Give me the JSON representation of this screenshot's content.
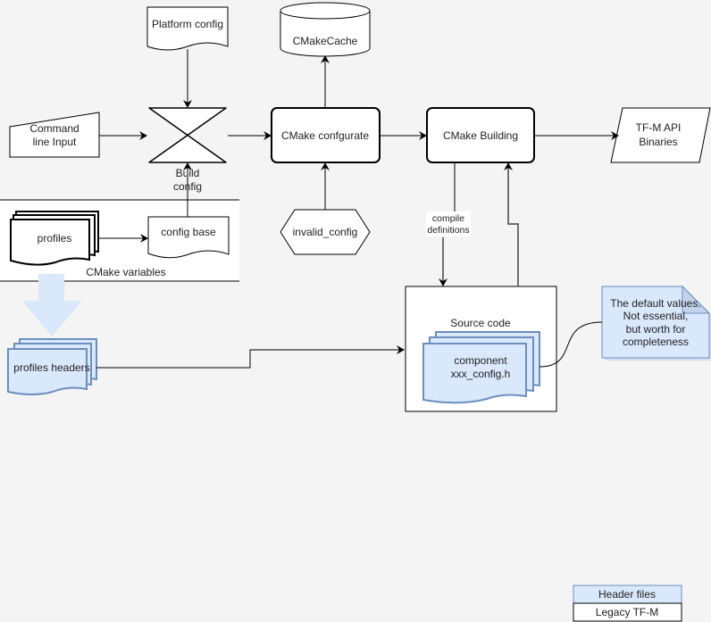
{
  "nodes": {
    "platform_config": "Platform config",
    "cmake_cache": "CMakeCache",
    "command_line_input": [
      "Command",
      "line Input"
    ],
    "cmake_configurate": "CMake confgurate",
    "cmake_building": "CMake Building",
    "tfm_api_binaries": [
      "TF-M API",
      "Binaries"
    ],
    "build_config": [
      "Build",
      "config"
    ],
    "profiles": "profiles",
    "config_base": "config base",
    "cmake_variables": "CMake variables",
    "invalid_config": "invalid_config",
    "compile_definitions": [
      "compile",
      "definitions"
    ],
    "source_code": "Source code",
    "component_config": [
      "component",
      "xxx_config.h"
    ],
    "profiles_headers": "profiles headers",
    "note": [
      "The default values.",
      "Not essential,",
      "but worth for",
      "completeness"
    ]
  },
  "legend": [
    {
      "label": "Header files",
      "color": "#dae8fc"
    },
    {
      "label": "Legacy TF-M",
      "color": "#ffffff"
    }
  ],
  "colors": {
    "header_fill": "#dae8fc",
    "header_stroke": "#6c8ebf",
    "background": "#f4f4f4"
  }
}
